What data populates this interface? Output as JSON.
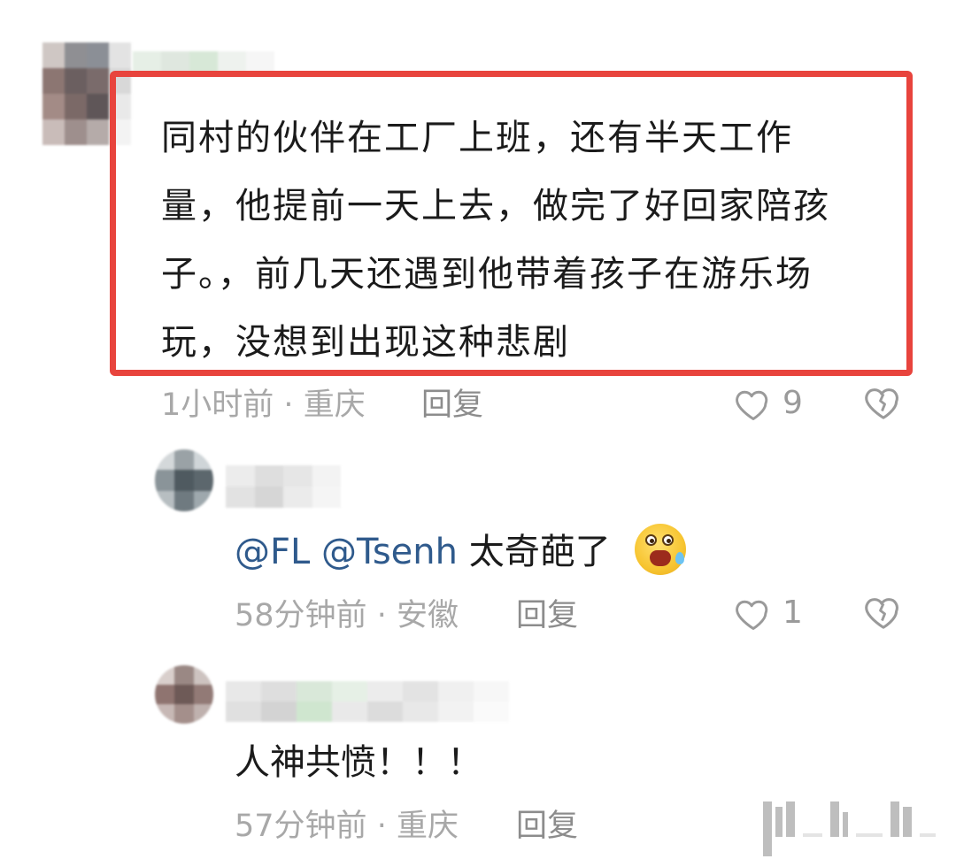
{
  "comments": [
    {
      "text_lines": [
        "同村的伙伴在工厂上班，还有半天工作",
        "量，他提前一天上去，做完了好回家陪孩",
        "子。，前几天还遇到他带着孩子在游乐场",
        "玩，没想到出现这种悲剧"
      ],
      "time": "1小时前",
      "separator": "·",
      "location": "重庆",
      "reply_label": "回复",
      "likes": "9",
      "highlighted": true
    }
  ],
  "replies": [
    {
      "mention_1": "@FL",
      "mention_2": "@Tsenh",
      "text": "太奇葩了",
      "emoji": "anxious-sweat-face",
      "time": "58分钟前",
      "separator": "·",
      "location": "安徽",
      "reply_label": "回复",
      "likes": "1"
    },
    {
      "text": "人神共愤！！！",
      "time": "57分钟前",
      "separator": "·",
      "location": "重庆",
      "reply_label": "回复"
    }
  ],
  "icons": {
    "like": "heart-outline-icon",
    "dislike": "broken-heart-icon"
  },
  "colors": {
    "highlight_border": "#e8443d",
    "mention": "#2f5a8c",
    "meta": "#a8a8a8"
  }
}
